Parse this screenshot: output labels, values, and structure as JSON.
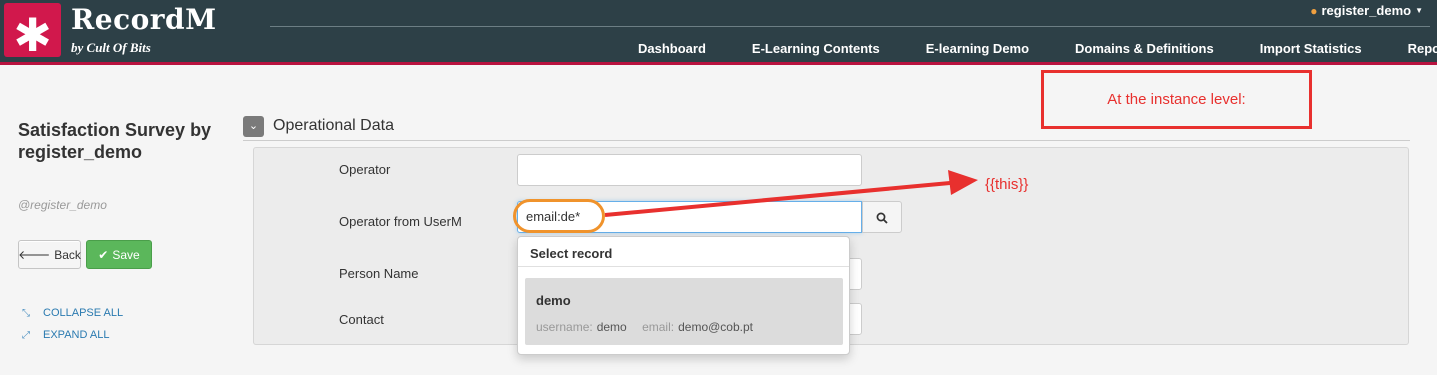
{
  "header": {
    "logo_glyph": "✱",
    "brand": "RecordM",
    "brand_sub": "by Cult Of Bits",
    "user": "register_demo",
    "nav": [
      "Dashboard",
      "E-Learning Contents",
      "E-learning Demo",
      "Domains & Definitions",
      "Import Statistics",
      "Reports"
    ]
  },
  "sidebar": {
    "title": "Satisfaction Survey by register_demo",
    "subtitle": "@register_demo",
    "back_label": "Back",
    "save_label": "Save",
    "collapse_label": "COLLAPSE ALL",
    "expand_label": "EXPAND ALL"
  },
  "section": {
    "title": "Operational Data",
    "fields": {
      "operator": {
        "label": "Operator",
        "value": ""
      },
      "operator_from_userm": {
        "label": "Operator from UserM",
        "value": "email:de*"
      },
      "person_name": {
        "label": "Person Name",
        "value": ""
      },
      "contact": {
        "label": "Contact",
        "value": ""
      }
    }
  },
  "dropdown": {
    "header": "Select record",
    "item": {
      "title": "demo",
      "username_label": "username:",
      "username": "demo",
      "email_label": "email:",
      "email": "demo@cob.pt"
    }
  },
  "annotations": {
    "box_text": "At the instance level:",
    "arrow_text": "{{this}}",
    "color": "#e8302e",
    "highlight_color": "#f0932c"
  },
  "colors": {
    "topbar": "#2d4047",
    "accent": "#d1184c",
    "save": "#5bb75b"
  }
}
